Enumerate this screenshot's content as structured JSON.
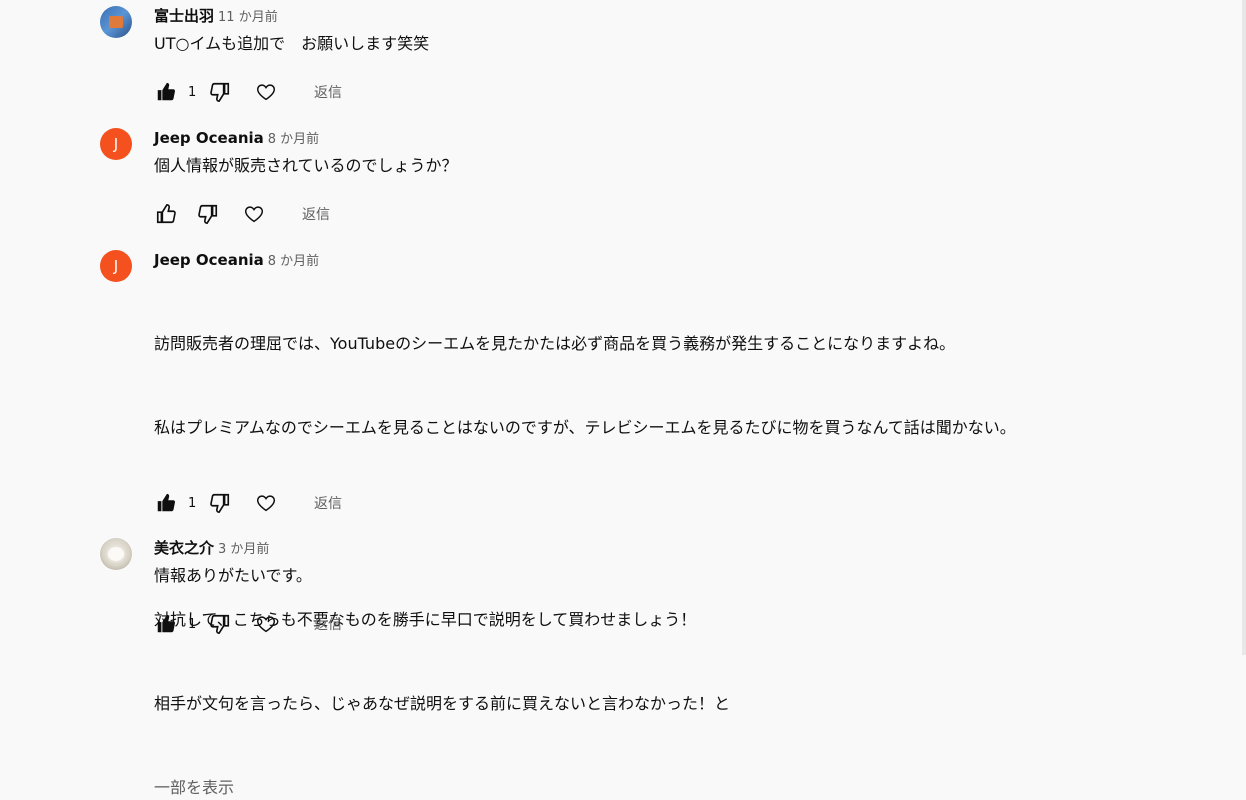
{
  "comments": [
    {
      "author": "富士出羽",
      "time": "11 か月前",
      "text": "UT○イムも追加で　お願いします笑笑",
      "likes": "1",
      "reply": "返信",
      "avatar": "profile-photo-icon"
    },
    {
      "author": "Jeep Oceania",
      "time": "8 か月前",
      "text": "個人情報が販売されているのでしょうか？",
      "likes": "",
      "reply": "返信",
      "avatar_letter": "J"
    },
    {
      "author": "Jeep Oceania",
      "time": "8 か月前",
      "line1": "訪問販売者の理屈では、YouTubeのシーエムを見たかたは必ず商品を買う義務が発生することになりますよね。",
      "line2": "私はプレミアムなのでシーエムを見ることはないのですが、テレビシーエムを見るたびに物を買うなんて話は聞かない。",
      "line3": "対抗して、こちらも不要なものを勝手に早口で説明をして買わせましょう！",
      "line4": "相手が文句を言ったら、じゃあなぜ説明をする前に買えないと言わなかった！と",
      "show_more": "一部を表示",
      "likes": "1",
      "reply": "返信",
      "avatar_letter": "J"
    },
    {
      "author": "美衣之介",
      "time": "3 か月前",
      "text": "情報ありがたいです。",
      "likes": "1",
      "reply": "返信",
      "avatar": "cat-photo-icon"
    }
  ],
  "colors": {
    "avatar_j": "#f4511e",
    "secondary_text": "#606060",
    "background": "#f9f9f9"
  }
}
